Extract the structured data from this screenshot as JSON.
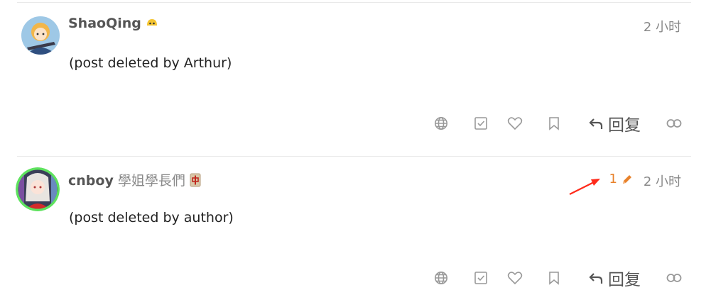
{
  "posts": [
    {
      "username": "ShaoQing",
      "user_title": "",
      "flair": "emoji-face-icon",
      "time": "2 小时",
      "edit_count": "",
      "body": "(post deleted by Arthur)"
    },
    {
      "username": "cnboy",
      "user_title": "學姐學長們",
      "flair": "mahjong-tile-icon",
      "time": "2 小时",
      "edit_count": "1",
      "body": "(post deleted by author)"
    }
  ],
  "actions": {
    "translate": "globe-icon",
    "solution": "check-square-icon",
    "like": "heart-icon",
    "bookmark": "bookmark-icon",
    "reply_label": "回复",
    "share": "link-icon"
  },
  "colors": {
    "edit_accent": "#e8812a",
    "online_ring": "#5ee25e",
    "annotation_arrow": "#ff2a1a"
  }
}
